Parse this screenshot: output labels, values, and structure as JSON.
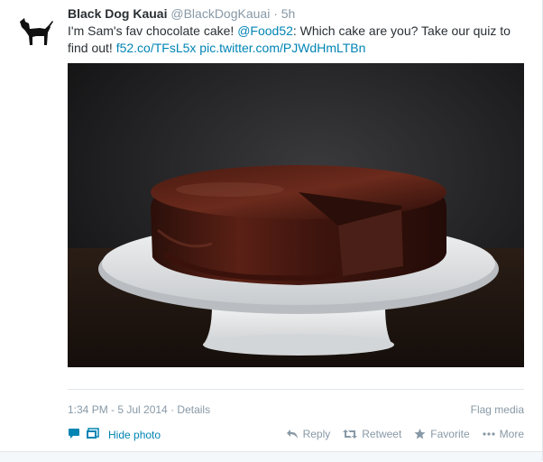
{
  "tweet": {
    "fullname": "Black Dog Kauai",
    "username": "@BlackDogKauai",
    "separator": "·",
    "time": "5h",
    "text_before": "I'm Sam's fav chocolate cake! ",
    "mention": "@Food52",
    "text_after": ": Which cake are you? Take our quiz to find out! ",
    "link1": "f52.co/TFsL5x",
    "link2": "pic.twitter.com/PJWdHmLTBn"
  },
  "meta": {
    "timestamp": "1:34 PM - 5 Jul 2014",
    "separator": "·",
    "details": "Details",
    "flag_media": "Flag media"
  },
  "actions": {
    "hide_photo": "Hide photo",
    "reply": "Reply",
    "retweet": "Retweet",
    "favorite": "Favorite",
    "more": "More"
  },
  "colors": {
    "link": "#0084b4",
    "muted": "#8899a6",
    "text": "#292f33"
  }
}
